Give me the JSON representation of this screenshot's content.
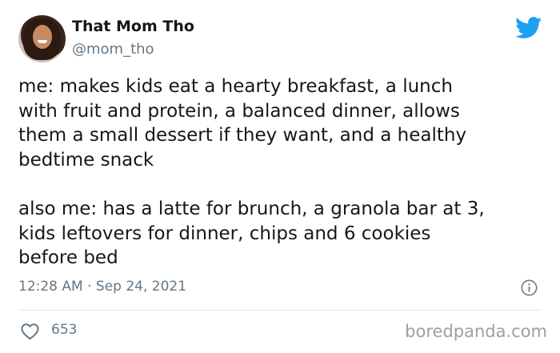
{
  "author": {
    "name": "That Mom Tho",
    "handle": "@mom_tho"
  },
  "tweet": {
    "text": "me: makes kids eat a hearty breakfast, a lunch\nwith fruit and protein, a balanced dinner, allows\nthem a small dessert if they want, and a healthy\nbedtime snack\n\nalso me: has a latte for brunch, a granola bar at 3,\nkids leftovers for dinner, chips and 6 cookies\nbefore bed",
    "timestamp": "12:28 AM · Sep 24, 2021",
    "likes": "653"
  },
  "watermark": "boredpanda.com",
  "icons": {
    "brand": "twitter-bird-icon",
    "info": "info-icon",
    "like": "heart-icon"
  },
  "colors": {
    "brand": "#1da1f2",
    "muted": "#657786",
    "divider": "#e1e8ed"
  }
}
